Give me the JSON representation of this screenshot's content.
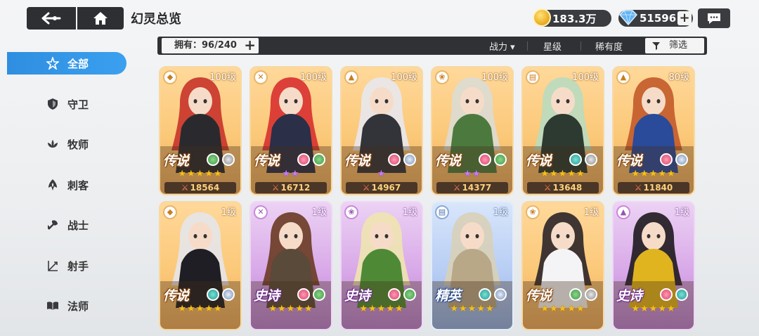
{
  "header": {
    "title": "幻灵总览",
    "gold": "183.3万",
    "gems": "51596",
    "plus": "+"
  },
  "sidebar": {
    "items": [
      {
        "label": "全部",
        "icon": "all-star-icon",
        "active": true
      },
      {
        "label": "守卫",
        "icon": "shield-icon"
      },
      {
        "label": "牧师",
        "icon": "lotus-icon"
      },
      {
        "label": "刺客",
        "icon": "dagger-icon"
      },
      {
        "label": "战士",
        "icon": "axe-icon"
      },
      {
        "label": "射手",
        "icon": "bow-icon"
      },
      {
        "label": "法师",
        "icon": "book-icon"
      }
    ]
  },
  "filter": {
    "owned": "拥有：96/240",
    "owned_plus": "+",
    "sort_power": "战力 ▾",
    "sort_stars": "星级",
    "sort_rarity": "稀有度",
    "filter_label": "筛选"
  },
  "cards": [
    {
      "level": "100级",
      "rarity": "传说",
      "rarity_type": "legend",
      "class_icon": "shield-icon",
      "elements": [
        "nature",
        "wind"
      ],
      "stars": "★★★★★",
      "star_color": "gold",
      "power": "18564",
      "hair": "#c8332a",
      "outfit": "#2a2a2e"
    },
    {
      "level": "100级",
      "rarity": "传说",
      "rarity_type": "legend",
      "class_icon": "axe-icon",
      "elements": [
        "fire",
        "nature"
      ],
      "stars": "★★",
      "star_color": "purple",
      "power": "16712",
      "hair": "#d8302f",
      "outfit": "#2b2f48"
    },
    {
      "level": "100级",
      "rarity": "传说",
      "rarity_type": "legend",
      "class_icon": "dagger-icon",
      "elements": [
        "fire",
        "light"
      ],
      "stars": "★",
      "star_color": "purple",
      "power": "14967",
      "hair": "#e8e8ee",
      "outfit": "#33333a"
    },
    {
      "level": "100级",
      "rarity": "传说",
      "rarity_type": "legend",
      "class_icon": "lotus-icon",
      "elements": [
        "fire",
        "nature"
      ],
      "stars": "★★",
      "star_color": "purple",
      "power": "14377",
      "hair": "#dcdcd4",
      "outfit": "#4c7a3e"
    },
    {
      "level": "100级",
      "rarity": "传说",
      "rarity_type": "legend",
      "class_icon": "book-icon",
      "elements": [
        "water",
        "wind"
      ],
      "stars": "★★★★★",
      "star_color": "gold",
      "power": "13648",
      "hair": "#b9dcc0",
      "outfit": "#2c3a32"
    },
    {
      "level": "80级",
      "rarity": "传说",
      "rarity_type": "legend",
      "class_icon": "dagger-icon",
      "elements": [
        "fire",
        "light"
      ],
      "stars": "★★★★★",
      "star_color": "gold",
      "power": "11840",
      "hair": "#c25a2a",
      "outfit": "#2a4a9a"
    },
    {
      "level": "1级",
      "rarity": "传说",
      "rarity_type": "legend",
      "class_icon": "shield-icon",
      "elements": [
        "water",
        "light"
      ],
      "stars": "★★★★★",
      "star_color": "gold",
      "power": "",
      "hair": "#e6e6ea",
      "outfit": "#1e1e24"
    },
    {
      "level": "1级",
      "rarity": "史诗",
      "rarity_type": "epic",
      "class_icon": "axe-icon",
      "elements": [
        "fire",
        "nature"
      ],
      "stars": "★★★★★",
      "star_color": "gold",
      "power": "",
      "hair": "#6a3a22",
      "outfit": "#5a4a3a"
    },
    {
      "level": "1级",
      "rarity": "史诗",
      "rarity_type": "epic",
      "class_icon": "lotus-icon",
      "elements": [
        "fire",
        "nature"
      ],
      "stars": "★★★★★",
      "star_color": "gold",
      "power": "",
      "hair": "#efe4b0",
      "outfit": "#4e8a36"
    },
    {
      "level": "1级",
      "rarity": "精英",
      "rarity_type": "elite",
      "class_icon": "book-icon",
      "elements": [
        "water",
        "light"
      ],
      "stars": "★★★★★",
      "star_color": "gold",
      "power": "",
      "hair": "#d8d0b8",
      "outfit": "#b8a888"
    },
    {
      "level": "1级",
      "rarity": "传说",
      "rarity_type": "legend",
      "class_icon": "lotus-icon",
      "elements": [
        "nature",
        "wind"
      ],
      "stars": "★★★★★",
      "star_color": "gold",
      "power": "",
      "hair": "#2a2428",
      "outfit": "#f4f4f6"
    },
    {
      "level": "1级",
      "rarity": "史诗",
      "rarity_type": "epic",
      "class_icon": "dagger-icon",
      "elements": [
        "fire",
        "water"
      ],
      "stars": "★★★★★",
      "star_color": "gold",
      "power": "",
      "hair": "#1e1a1e",
      "outfit": "#e0b41e"
    }
  ]
}
